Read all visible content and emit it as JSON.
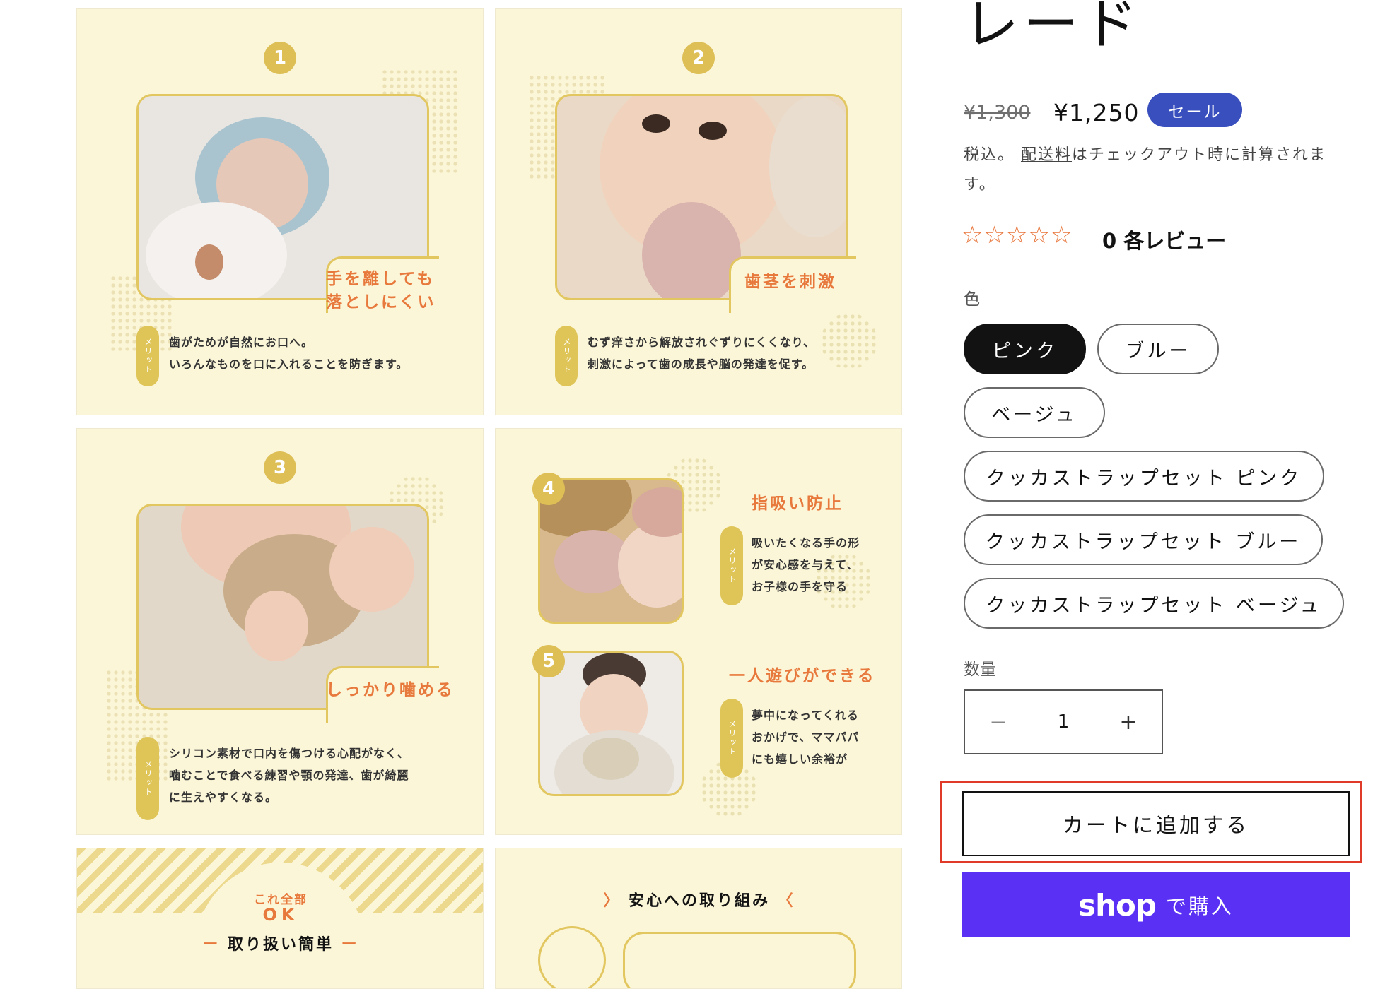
{
  "gallery": {
    "tiles": [
      {
        "number": "1",
        "catch": [
          "手を離しても",
          "落としにくい"
        ],
        "tag": "メリット",
        "desc": [
          "歯がためが自然にお口へ。",
          "いろんなものを口に入れることを防ぎます。"
        ]
      },
      {
        "number": "2",
        "catch": [
          "歯茎を刺激"
        ],
        "tag": "メリット",
        "desc": [
          "むず痒さから解放されぐずりにくくなり、",
          "刺激によって歯の成長や脳の発達を促す。"
        ]
      },
      {
        "number": "3",
        "catch": [
          "しっかり噛める"
        ],
        "tag": "メリット",
        "desc": [
          "シリコン素材で口内を傷つける心配がなく、",
          "噛むことで食べる練習や顎の発達、歯が綺麗",
          "に生えやすくなる。"
        ]
      },
      {
        "items": [
          {
            "number": "4",
            "catch": "指吸い防止",
            "tag": "メリット",
            "desc": [
              "吸いたくなる手の形",
              "が安心感を与えて、",
              "お子様の手を守る"
            ]
          },
          {
            "number": "5",
            "catch": "一人遊びができる",
            "tag": "メリット",
            "desc": [
              "夢中になってくれる",
              "おかげで、ママパパ",
              "にも嬉しい余裕が"
            ]
          }
        ]
      },
      {
        "small": "これ全部",
        "ok": "OK",
        "heading": "取り扱い簡単"
      },
      {
        "heading": "安心への取り組み"
      }
    ]
  },
  "product": {
    "title": "レード",
    "compare_price": "¥1,300",
    "price": "¥1,250",
    "sale_badge": "セール",
    "tax_prefix": "税込。 ",
    "shipping_link": "配送料",
    "tax_suffix": "はチェックアウト時に計算されます。",
    "rating": 0,
    "reviews_text": "0 各レビュー",
    "color_label": "色",
    "colors": [
      "ピンク",
      "ブルー",
      "ベージュ",
      "クッカストラップセット ピンク",
      "クッカストラップセット ブルー",
      "クッカストラップセット ベージュ"
    ],
    "selected_color": "ピンク",
    "quantity_label": "数量",
    "quantity": "1",
    "minus": "−",
    "plus": "+",
    "add_to_cart": "カートに追加する",
    "shop_pay_logo": "shop",
    "shop_pay_label": "で購入"
  },
  "colors": {
    "accent_orange": "#e8793d",
    "accent_gold": "#ddbf56",
    "sale_badge": "#3a4fbe",
    "shop_pay": "#5a31f4",
    "highlight": "#e03a2a"
  }
}
